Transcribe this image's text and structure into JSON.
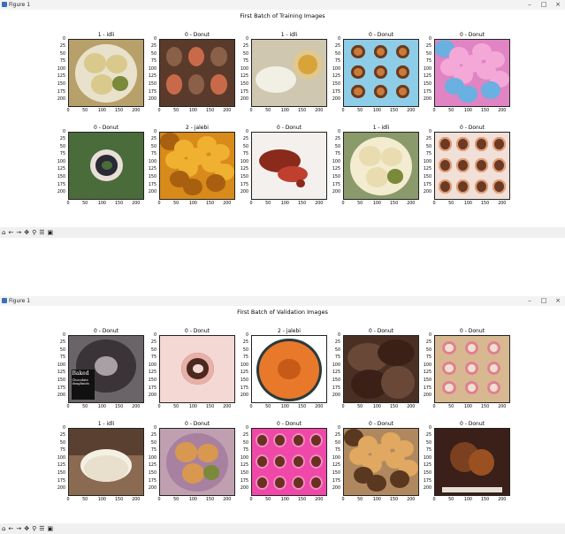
{
  "windows": [
    {
      "title": "Figure 1",
      "suptitle": "First Batch of Training Images",
      "panels": [
        {
          "label": "1 - idli",
          "bg": "#b8a06a",
          "fg": "#d9c98c",
          "ring": "#e8e2cc",
          "shape": "plate"
        },
        {
          "label": "0 - Donut",
          "bg": "#5a3a2a",
          "fg": "#c86a4a",
          "ring": "#8a6048",
          "shape": "box"
        },
        {
          "label": "1 - idli",
          "bg": "#cfc7b0",
          "fg": "#f2efe5",
          "ring": "#d8a43a",
          "shape": "bowl"
        },
        {
          "label": "0 - Donut",
          "bg": "#8ecde8",
          "fg": "#c77a3a",
          "ring": "#6a3a1e",
          "shape": "scatter"
        },
        {
          "label": "0 - Donut",
          "bg": "#e084c4",
          "fg": "#f4a8d8",
          "ring": "#6ab0e0",
          "shape": "pile"
        },
        {
          "label": "0 - Donut",
          "bg": "#4a6b3a",
          "fg": "#2a2a34",
          "ring": "#e8e0d8",
          "shape": "single"
        },
        {
          "label": "2 - jalebi",
          "bg": "#d88a1a",
          "fg": "#f0b030",
          "ring": "#a86010",
          "shape": "pile"
        },
        {
          "label": "0 - Donut",
          "bg": "#f4f0ee",
          "fg": "#8a2a1a",
          "ring": "#c04030",
          "shape": "splash"
        },
        {
          "label": "1 - idli",
          "bg": "#8a9a6a",
          "fg": "#e8dcb0",
          "ring": "#f4ecd0",
          "shape": "plate"
        },
        {
          "label": "0 - Donut",
          "bg": "#f0e0d8",
          "fg": "#6a3a24",
          "ring": "#e8a078",
          "shape": "grid"
        }
      ],
      "toolbar_icons": [
        "home-icon",
        "back-icon",
        "forward-icon",
        "pan-icon",
        "zoom-icon",
        "configure-icon",
        "save-icon"
      ]
    },
    {
      "title": "Figure 1",
      "suptitle": "First Batch of Validation Images",
      "panels": [
        {
          "label": "0 - Donut",
          "bg": "#6a6468",
          "fg": "#3a3438",
          "ring": "#a8a0a4",
          "shape": "baked",
          "caption1": "Baked",
          "caption2": "Chocolate doughnuts"
        },
        {
          "label": "0 - Donut",
          "bg": "#f4d8d4",
          "fg": "#4a2a1e",
          "ring": "#e8b0a8",
          "shape": "single"
        },
        {
          "label": "2 - jalebi",
          "bg": "#ffffff",
          "fg": "#e8782a",
          "ring": "#2a3a3a",
          "shape": "round"
        },
        {
          "label": "0 - Donut",
          "bg": "#4a3024",
          "fg": "#3a2016",
          "ring": "#6a4838",
          "shape": "stack"
        },
        {
          "label": "0 - Donut",
          "bg": "#d8b890",
          "fg": "#f0e0d0",
          "ring": "#e08090",
          "shape": "scatter"
        },
        {
          "label": "1 - idli",
          "bg": "#8a6a50",
          "fg": "#f4f0e4",
          "ring": "#e8e0cc",
          "shape": "idli"
        },
        {
          "label": "0 - Donut",
          "bg": "#c0a0b0",
          "fg": "#d89850",
          "ring": "#a880a0",
          "shape": "plate"
        },
        {
          "label": "0 - Donut",
          "bg": "#f048a8",
          "fg": "#6a3020",
          "ring": "#f48cc8",
          "shape": "grid"
        },
        {
          "label": "0 - Donut",
          "bg": "#b08860",
          "fg": "#e0a860",
          "ring": "#5a3820",
          "shape": "pile"
        },
        {
          "label": "0 - Donut",
          "bg": "#3a2018",
          "fg": "#7a4020",
          "ring": "#2a1810",
          "shape": "dark"
        }
      ],
      "toolbar_icons": [
        "home-icon",
        "back-icon",
        "forward-icon",
        "pan-icon",
        "zoom-icon",
        "configure-icon",
        "save-icon"
      ]
    }
  ],
  "axes": {
    "yticks": [
      "0",
      "25",
      "50",
      "75",
      "100",
      "125",
      "150",
      "175",
      "200"
    ],
    "xticks": [
      "0",
      "50",
      "100",
      "150",
      "200"
    ],
    "ylim": [
      0,
      224
    ],
    "xlim": [
      0,
      224
    ]
  },
  "window_buttons": [
    "–",
    "□",
    "×"
  ]
}
